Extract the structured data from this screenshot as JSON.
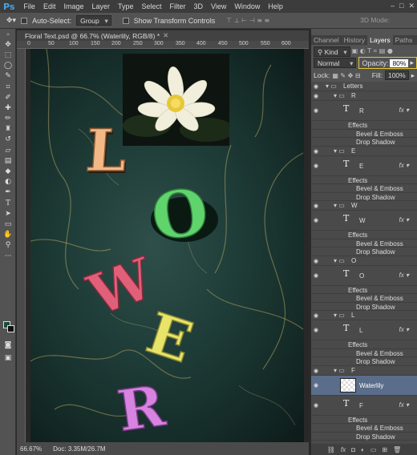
{
  "menubar": {
    "logo": "Ps",
    "items": [
      "File",
      "Edit",
      "Image",
      "Layer",
      "Type",
      "Select",
      "Filter",
      "3D",
      "View",
      "Window",
      "Help"
    ]
  },
  "options": {
    "auto_select_label": "Auto-Select:",
    "group_value": "Group",
    "transform_label": "Show Transform Controls",
    "mode3d_label": "3D Mode:"
  },
  "document": {
    "tab_title": "Floral Text.psd @ 66.7% (Waterlily, RGB/8) *",
    "ruler_ticks": [
      "0",
      "50",
      "100",
      "150",
      "200",
      "250",
      "300",
      "350",
      "400",
      "450",
      "500",
      "550",
      "600"
    ],
    "zoom": "66.67%",
    "doc_size": "Doc: 3.35M/26.7M"
  },
  "canvas_letters": [
    "L",
    "O",
    "W",
    "E",
    "R"
  ],
  "panel": {
    "tabs": [
      "Channel",
      "History",
      "Layers",
      "Paths"
    ],
    "active_tab": "Layers",
    "kind_label": "Kind",
    "blend_mode": "Normal",
    "opacity_label": "Opacity:",
    "opacity_value": "80%",
    "lock_label": "Lock:",
    "fill_label": "Fill:",
    "fill_value": "100%"
  },
  "layers": {
    "group": "Letters",
    "effects_label": "Effects",
    "bevel_label": "Bevel & Emboss",
    "shadow_label": "Drop Shadow",
    "subgroups": [
      {
        "name": "R",
        "layer": "R"
      },
      {
        "name": "E",
        "layer": "E"
      },
      {
        "name": "W",
        "layer": "W"
      },
      {
        "name": "O",
        "layer": "O"
      },
      {
        "name": "L",
        "layer": "L"
      },
      {
        "name": "F",
        "image_layer": "Waterlily",
        "layer": "F"
      }
    ]
  },
  "colors": {
    "accent": "#e0c63b",
    "L": "#f2b886",
    "O": "#5fd36c",
    "W": "#e0607a",
    "E": "#e8e46a",
    "R": "#d783e0"
  }
}
